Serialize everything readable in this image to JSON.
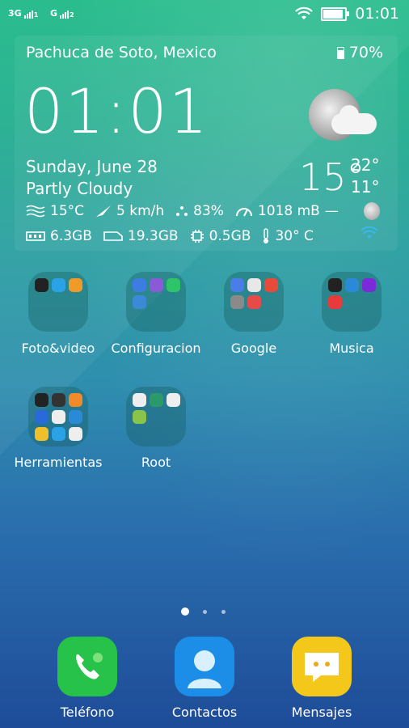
{
  "status_bar": {
    "sim1": "3G",
    "sim1_sub": "1",
    "sim2": "G",
    "sim2_sub": "2",
    "time": "01:01",
    "icons": [
      "wifi-icon",
      "battery-icon"
    ]
  },
  "widget": {
    "location": "Pachuca de Soto, Mexico",
    "battery_percent": "70%",
    "battery_level": 0.7,
    "clock": "01:01",
    "date": "Sunday, June 28",
    "condition": "Partly Cloudy",
    "temperature": "15°",
    "high": "22°",
    "low": "11°",
    "feels_like": "15°C",
    "wind": "5 km/h",
    "humidity": "83%",
    "pressure": "1018 mB",
    "pressure_trend": "—",
    "ram": "6.3GB",
    "storage": "19.3GB",
    "cpu": "0.5GB",
    "device_temp": "30° C"
  },
  "folders": [
    {
      "label": "Foto&video",
      "apps": [
        "camera-app",
        "photos-app",
        "editor-app"
      ],
      "colors": [
        "#222",
        "#2aa3e6",
        "#f09a2a"
      ]
    },
    {
      "label": "Configuracion",
      "apps": [
        "settings-app",
        "theme-app",
        "security-app",
        "weather-app"
      ],
      "colors": [
        "#3b7de0",
        "#8a5ad8",
        "#2ec46a",
        "#3a8ad8"
      ]
    },
    {
      "label": "Google",
      "apps": [
        "google-app",
        "play-store-app",
        "chrome-app",
        "settings-google-app",
        "voice-search-app"
      ],
      "colors": [
        "#4a7de8",
        "#e8e8e8",
        "#e84a3a",
        "#8a8a8a",
        "#e84a4a"
      ]
    },
    {
      "label": "Musica",
      "apps": [
        "music-app",
        "radio-app",
        "viper-app",
        "headphones-app"
      ],
      "colors": [
        "#222",
        "#2a8ad8",
        "#7a2ad8",
        "#e83a3a"
      ]
    },
    {
      "label": "Herramientas",
      "apps": [
        "clock-app",
        "calculator-app",
        "notes-app",
        "compass-app",
        "gamepad-app",
        "mail-app",
        "chat-app",
        "contacts-app",
        "calendar-app"
      ],
      "colors": [
        "#222",
        "#333",
        "#f08a2a",
        "#2a6ad8",
        "#eee",
        "#2a8ad8",
        "#f0c02a",
        "#2aa3e6",
        "#eee"
      ]
    },
    {
      "label": "Root",
      "apps": [
        "superuser-app",
        "terminal-app",
        "root-checker-app",
        "android-app"
      ],
      "colors": [
        "#eee",
        "#2a9a6a",
        "#eee",
        "#8ac44a"
      ]
    }
  ],
  "pager": {
    "pages": 3,
    "active": 0
  },
  "dock": [
    {
      "label": "Teléfono",
      "color": "#2ec84a"
    },
    {
      "label": "Contactos",
      "color": "#1a8ee8"
    },
    {
      "label": "Mensajes",
      "color": "#f4c81a"
    }
  ]
}
